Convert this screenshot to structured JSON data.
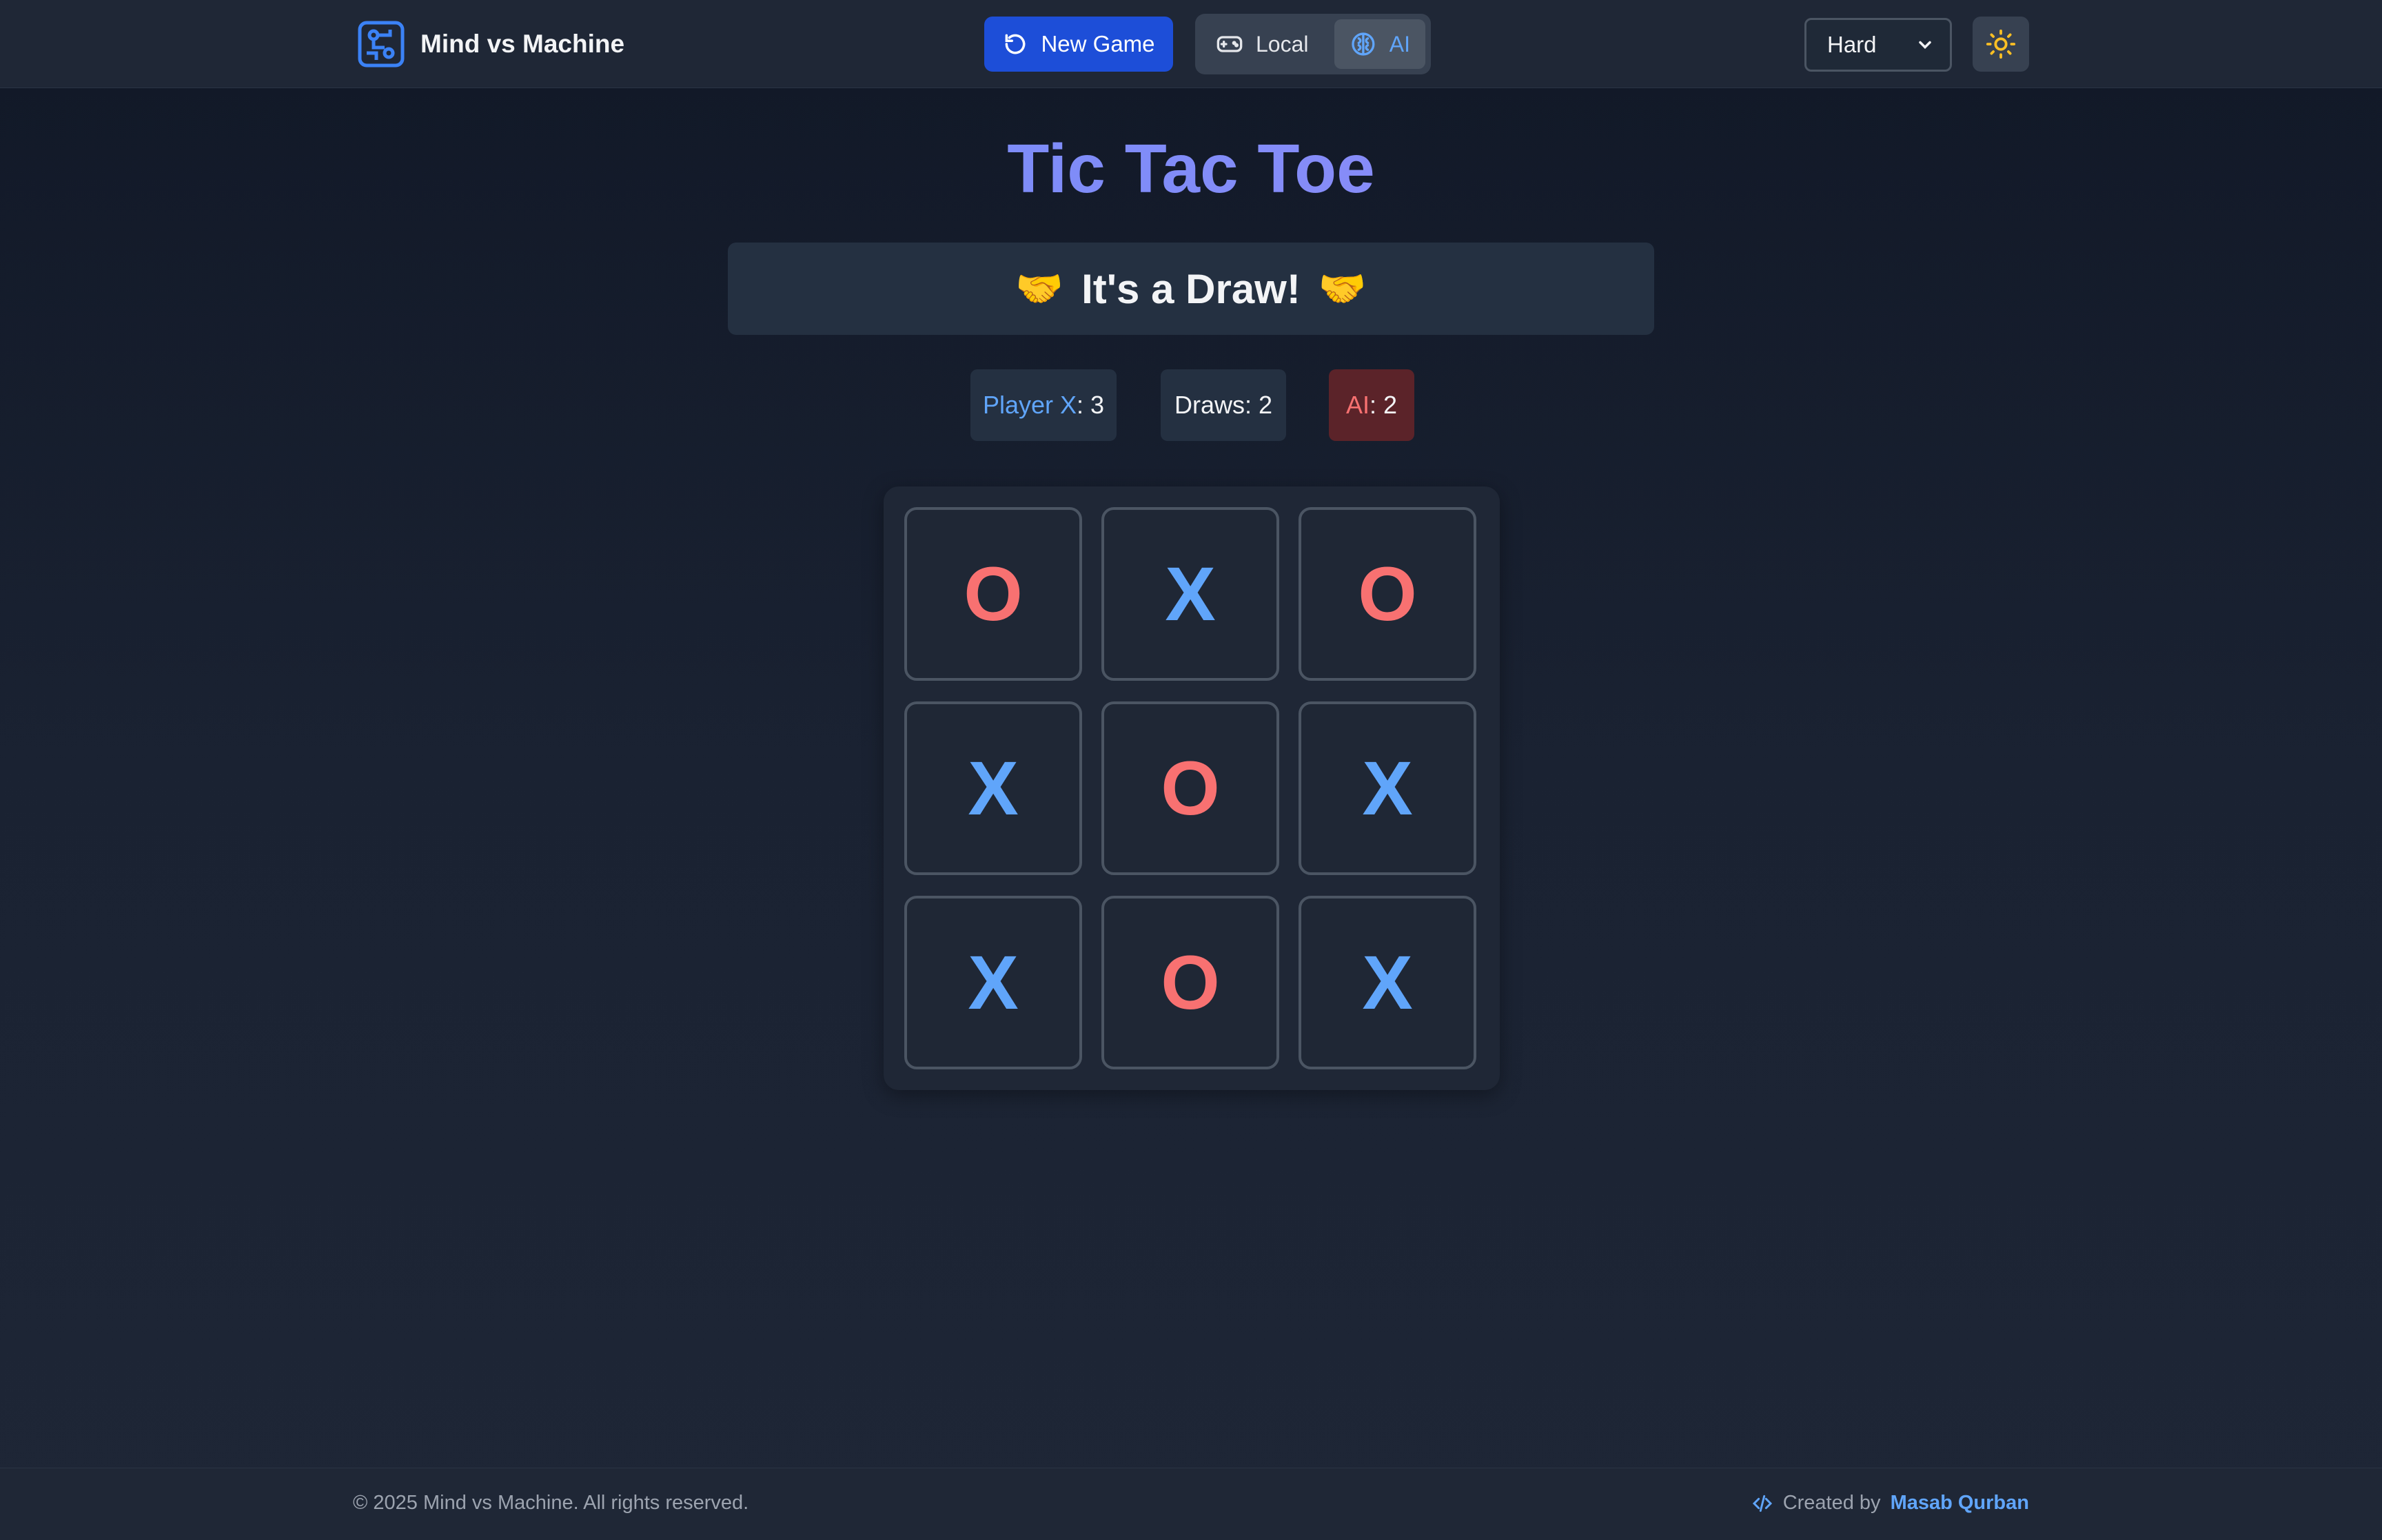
{
  "header": {
    "brand": "Mind vs Machine",
    "new_game_label": "New Game",
    "modes": [
      {
        "label": "Local",
        "icon": "gamepad-icon",
        "active": false
      },
      {
        "label": "AI",
        "icon": "brain-icon",
        "active": true
      }
    ],
    "difficulty": {
      "selected": "Hard"
    },
    "theme_icon": "sun-icon"
  },
  "main": {
    "title": "Tic Tac Toe",
    "status": {
      "text": "It's a Draw!",
      "emoji": "🤝"
    },
    "scores": {
      "player_label": "Player X",
      "player_value": ": 3",
      "draws_label": "Draws: 2",
      "ai_label": "AI",
      "ai_value": ": 2"
    },
    "board": [
      "O",
      "X",
      "O",
      "X",
      "O",
      "X",
      "X",
      "O",
      "X"
    ]
  },
  "footer": {
    "copyright": "© 2025 Mind vs Machine. All rights reserved.",
    "created_by": "Created by",
    "author": "Masab Qurban"
  },
  "colors": {
    "x": "#60a5fa",
    "o": "#f87171",
    "primary": "#1d4ed8"
  }
}
